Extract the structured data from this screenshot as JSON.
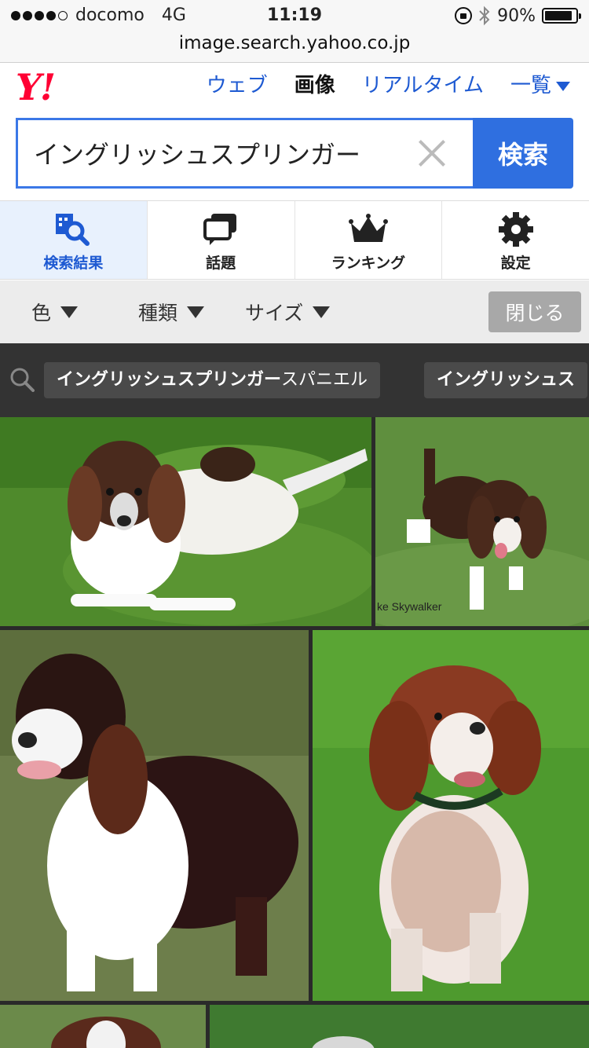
{
  "status_bar": {
    "carrier": "docomo",
    "network": "4G",
    "time": "11:19",
    "battery_percent": "90%",
    "battery_level": 0.9
  },
  "browser": {
    "url": "image.search.yahoo.co.jp"
  },
  "header": {
    "logo_text": "Y!",
    "nav": {
      "web": "ウェブ",
      "images": "画像",
      "realtime": "リアルタイム",
      "list": "一覧"
    }
  },
  "search": {
    "query": "イングリッシュスプリンガー",
    "button_label": "検索"
  },
  "tabs": [
    {
      "label": "検索結果",
      "icon": "search-results-icon"
    },
    {
      "label": "話題",
      "icon": "chat-bubbles-icon"
    },
    {
      "label": "ランキング",
      "icon": "crown-icon"
    },
    {
      "label": "設定",
      "icon": "gear-icon"
    }
  ],
  "filters": {
    "color": "色",
    "type": "種類",
    "size": "サイズ",
    "close": "閉じる"
  },
  "related": [
    {
      "bold": "イングリッシュスプリンガー",
      "rest": "スパニエル"
    },
    {
      "bold": "イングリッシュス",
      "rest": ""
    }
  ],
  "images": [
    {
      "alt": "springer spaniel lying on grass",
      "caption": ""
    },
    {
      "alt": "springer spaniel puppy on grass",
      "caption": "ke Skywalker"
    },
    {
      "alt": "springer spaniel standing",
      "caption": ""
    },
    {
      "alt": "liver and white springer spaniel running",
      "caption": ""
    }
  ],
  "colors": {
    "accent": "#2f6fe0",
    "link": "#1e5ad2",
    "yahoo_red": "#ff0033"
  }
}
